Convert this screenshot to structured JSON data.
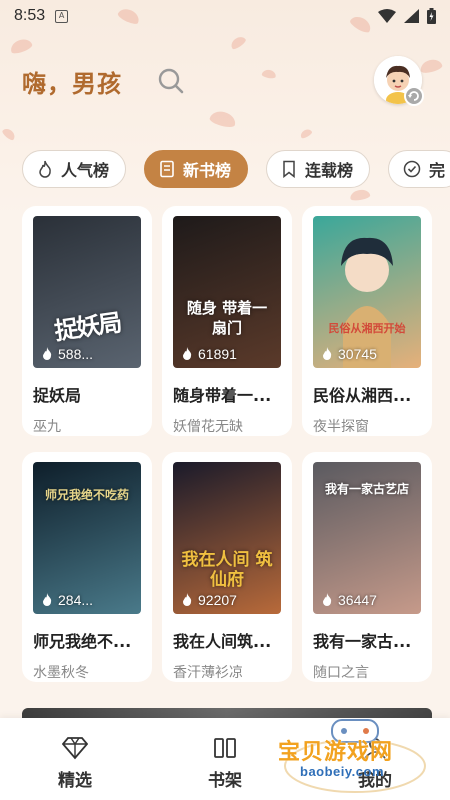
{
  "status_bar": {
    "time": "8:53",
    "sim_icon_letter": "A"
  },
  "header": {
    "greeting": "嗨，男孩"
  },
  "tabs": [
    {
      "label": "人气榜",
      "icon": "flame-icon",
      "active": false
    },
    {
      "label": "新书榜",
      "icon": "book-icon",
      "active": true
    },
    {
      "label": "连载榜",
      "icon": "bookmark-icon",
      "active": false
    },
    {
      "label": "完",
      "icon": "check-circle-icon",
      "active": false
    }
  ],
  "books": [
    {
      "title": "捉妖局",
      "author": "巫九",
      "heat": "588...",
      "cover_text": "捉妖局",
      "cover_colors": [
        "#2a3038",
        "#5a6470"
      ]
    },
    {
      "title": "随身带着一...",
      "author": "妖僧花无缺",
      "heat": "61891",
      "cover_text": "随身 带着一扇门",
      "cover_colors": [
        "#1e1a1a",
        "#5b3a2a"
      ]
    },
    {
      "title": "民俗从湘西...",
      "author": "夜半探窗",
      "heat": "30745",
      "cover_text": "民俗从湘西开始",
      "cover_colors": [
        "#3aa79a",
        "#e6b07a"
      ]
    },
    {
      "title": "师兄我绝不...",
      "author": "水墨秋冬",
      "heat": "284...",
      "cover_text": "师兄我绝不吃药",
      "cover_colors": [
        "#0e1e2a",
        "#4a7a8a"
      ]
    },
    {
      "title": "我在人间筑...",
      "author": "香汗薄衫凉",
      "heat": "92207",
      "cover_text": "我在人间 筑仙府",
      "cover_colors": [
        "#1a1a2a",
        "#b86a3a"
      ]
    },
    {
      "title": "我有一家古...",
      "author": "随口之言",
      "heat": "36447",
      "cover_text": "我有一家古艺店",
      "cover_colors": [
        "#5a5a60",
        "#c69a8a"
      ]
    }
  ],
  "bottom_nav": [
    {
      "label": "精选",
      "icon": "diamond-icon"
    },
    {
      "label": "书架",
      "icon": "bookshelf-icon"
    },
    {
      "label": "我的",
      "icon": "user-icon"
    }
  ],
  "watermark": {
    "text": "宝贝游戏网",
    "url": "baobeiy.com"
  }
}
